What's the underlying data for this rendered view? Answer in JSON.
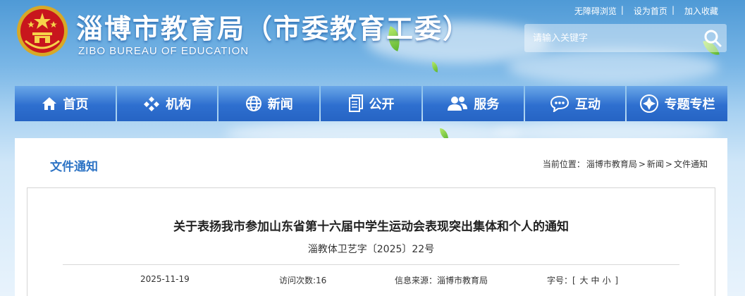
{
  "site": {
    "title": "淄博市教育局（市委教育工委）",
    "subtitle": "ZIBO BUREAU OF EDUCATION"
  },
  "top_links": [
    {
      "label": "无障碍浏览"
    },
    {
      "label": "设为首页"
    },
    {
      "label": "加入收藏"
    }
  ],
  "top_link_separator": "|",
  "search": {
    "placeholder": "请输入关键字",
    "icon": "search-icon"
  },
  "nav": [
    {
      "label": "首页",
      "icon": "home-icon"
    },
    {
      "label": "机构",
      "icon": "org-icon"
    },
    {
      "label": "新闻",
      "icon": "globe-icon"
    },
    {
      "label": "公开",
      "icon": "document-icon"
    },
    {
      "label": "服务",
      "icon": "users-icon"
    },
    {
      "label": "互动",
      "icon": "chat-icon"
    },
    {
      "label": "专题专栏",
      "icon": "topics-icon"
    }
  ],
  "section": {
    "title": "文件通知"
  },
  "breadcrumb": {
    "prefix": "当前位置：",
    "items": [
      "淄博市教育局",
      "新闻",
      "文件通知"
    ],
    "separator": ">"
  },
  "article": {
    "title": "关于表扬我市参加山东省第十六届中学生运动会表现突出集体和个人的通知",
    "doc_no": "淄教体卫艺字〔2025〕22号",
    "date": "2025-11-19",
    "views_label": "访问次数:",
    "views": "16",
    "source_label": "信息来源：",
    "source": "淄博市教育局",
    "font_size_label": "字号：",
    "font_sizes": [
      "大",
      "中",
      "小"
    ],
    "bracket_open": "[",
    "bracket_close": "]"
  },
  "colors": {
    "nav_blue": "#2e6fcf",
    "section_title": "#2e74c5"
  }
}
